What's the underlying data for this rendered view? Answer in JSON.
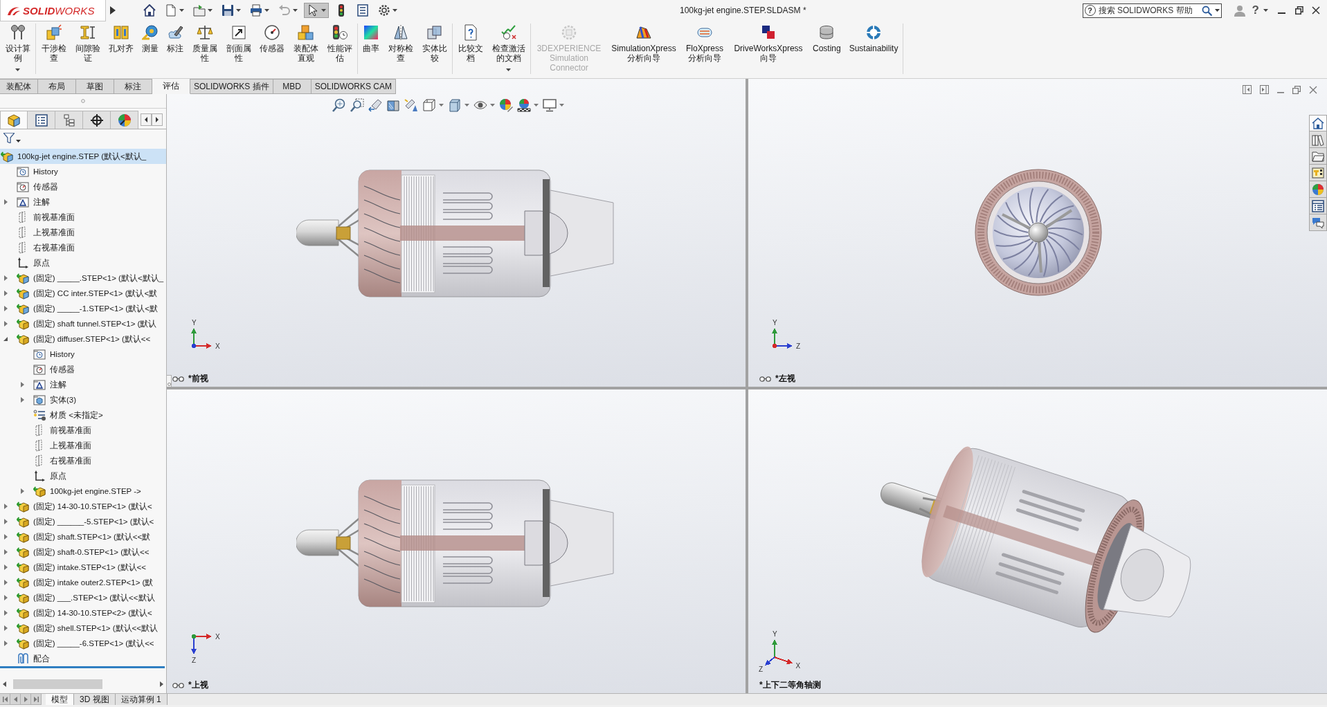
{
  "title_bar": {
    "logo": "**SOLID**WORKS",
    "quick_access": [
      {
        "dropdown": false,
        "disabled": false,
        "selected": false
      },
      {
        "dropdown": true,
        "disabled": false,
        "selected": false
      },
      {
        "dropdown": true,
        "disabled": false,
        "selected": false
      },
      {
        "dropdown": true,
        "disabled": false,
        "selected": false
      },
      {
        "dropdown": true,
        "disabled": false,
        "selected": false
      },
      {
        "dropdown": true,
        "disabled": true,
        "selected": false
      },
      {
        "dropdown": true,
        "disabled": false,
        "selected": true
      },
      {
        "dropdown": false,
        "disabled": false,
        "selected": false
      },
      {
        "dropdown": false,
        "disabled": false,
        "selected": false
      },
      {
        "dropdown": true,
        "disabled": false,
        "selected": false
      }
    ],
    "document_title": "100kg-jet engine.STEP.SLDASM *",
    "help_search": {
      "help_mark": "?",
      "placeholder": "搜索 SOLIDWORKS 帮助"
    },
    "help_menu": "?"
  },
  "command_manager": {
    "groups": [
      {
        "commands": [
          {
            "label": "设计算例",
            "dropdown": true,
            "disabled": false
          }
        ]
      },
      {
        "commands": [
          {
            "label": "干涉检查",
            "dropdown": false,
            "disabled": false
          },
          {
            "label": "间隙验证",
            "dropdown": false,
            "disabled": false
          },
          {
            "label": "孔对齐",
            "dropdown": false,
            "disabled": false
          },
          {
            "label": "测量",
            "dropdown": false,
            "disabled": false
          },
          {
            "label": "标注",
            "dropdown": false,
            "disabled": false
          },
          {
            "label": "质量属性",
            "dropdown": false,
            "disabled": false
          },
          {
            "label": "剖面属性",
            "dropdown": false,
            "disabled": false
          },
          {
            "label": "传感器",
            "dropdown": false,
            "disabled": false
          },
          {
            "label": "装配体直观",
            "dropdown": false,
            "disabled": false
          },
          {
            "label": "性能评估",
            "dropdown": false,
            "disabled": false
          }
        ]
      },
      {
        "commands": [
          {
            "label": "曲率",
            "dropdown": false,
            "disabled": false
          },
          {
            "label": "对称检查",
            "dropdown": false,
            "disabled": false
          },
          {
            "label": "实体比较",
            "dropdown": false,
            "disabled": false
          }
        ]
      },
      {
        "commands": [
          {
            "label": "比较文档",
            "dropdown": false,
            "disabled": false
          },
          {
            "label": "检查激活的文档",
            "dropdown": true,
            "disabled": false
          }
        ]
      },
      {
        "commands": [
          {
            "label": "3DEXPERIENCE Simulation Connector",
            "dropdown": false,
            "disabled": true
          },
          {
            "label": "SimulationXpress 分析向导",
            "dropdown": false,
            "disabled": false
          },
          {
            "label": "FloXpress 分析向导",
            "dropdown": false,
            "disabled": false
          },
          {
            "label": "DriveWorksXpress 向导",
            "dropdown": false,
            "disabled": false
          },
          {
            "label": "Costing",
            "dropdown": false,
            "disabled": false
          },
          {
            "label": "Sustainability",
            "dropdown": false,
            "disabled": false
          }
        ]
      }
    ]
  },
  "command_tabs": [
    {
      "label": "装配体",
      "selected": false
    },
    {
      "label": "布局",
      "selected": false
    },
    {
      "label": "草图",
      "selected": false
    },
    {
      "label": "标注",
      "selected": false
    },
    {
      "label": "评估",
      "selected": true
    },
    {
      "label": "SOLIDWORKS 插件",
      "selected": false
    },
    {
      "label": "MBD",
      "selected": false
    },
    {
      "label": "SOLIDWORKS CAM",
      "selected": false
    }
  ],
  "feature_manager": {
    "panel_tabs": [
      {
        "selected": true
      },
      {
        "selected": false
      },
      {
        "selected": false
      },
      {
        "selected": false
      },
      {
        "selected": false
      }
    ],
    "feature_tree": [
      {
        "kind": "assembly",
        "label": "100kg-jet engine.STEP (默认<默认_",
        "selected": true,
        "children": [
          {
            "kind": "history",
            "label": "History",
            "selected": false
          },
          {
            "kind": "sensors",
            "label": "传感器",
            "selected": false
          },
          {
            "kind": "annotations",
            "label": "注解",
            "selected": false,
            "expanded": false
          },
          {
            "kind": "plane",
            "label": "前视基准面",
            "selected": false
          },
          {
            "kind": "plane",
            "label": "上视基准面",
            "selected": false
          },
          {
            "kind": "plane",
            "label": "右视基准面",
            "selected": false
          },
          {
            "kind": "origin",
            "label": "原点",
            "selected": false
          },
          {
            "kind": "assembly",
            "label": "(固定) _____.STEP<1> (默认<默认_",
            "selected": false,
            "expanded": false
          },
          {
            "kind": "assembly",
            "label": "(固定) CC inter.STEP<1> (默认<默",
            "selected": false,
            "expanded": false
          },
          {
            "kind": "assembly",
            "label": "(固定) _____-1.STEP<1> (默认<默",
            "selected": false,
            "expanded": false
          },
          {
            "kind": "part",
            "label": "(固定) shaft tunnel.STEP<1> (默认",
            "selected": false,
            "expanded": false
          },
          {
            "kind": "part",
            "label": "(固定) diffuser.STEP<1> (默认<<",
            "selected": false,
            "expanded": true,
            "children": [
              {
                "kind": "history",
                "label": "History",
                "selected": false
              },
              {
                "kind": "sensors",
                "label": "传感器",
                "selected": false
              },
              {
                "kind": "annotations",
                "label": "注解",
                "selected": false,
                "expanded": false
              },
              {
                "kind": "bodies",
                "label": "实体(3)",
                "selected": false,
                "expanded": false
              },
              {
                "kind": "material",
                "label": "材质 <未指定>",
                "selected": false
              },
              {
                "kind": "plane",
                "label": "前视基准面",
                "selected": false
              },
              {
                "kind": "plane",
                "label": "上视基准面",
                "selected": false
              },
              {
                "kind": "plane",
                "label": "右视基准面",
                "selected": false
              },
              {
                "kind": "origin",
                "label": "原点",
                "selected": false
              },
              {
                "kind": "part",
                "label": "100kg-jet engine.STEP ->",
                "selected": false,
                "expanded": false
              }
            ]
          },
          {
            "kind": "part",
            "label": "(固定) 14-30-10.STEP<1> (默认<",
            "selected": false,
            "expanded": false
          },
          {
            "kind": "part",
            "label": "(固定) ______-5.STEP<1> (默认<",
            "selected": false,
            "expanded": false
          },
          {
            "kind": "part",
            "label": "(固定) shaft.STEP<1> (默认<<默",
            "selected": false,
            "expanded": false
          },
          {
            "kind": "part",
            "label": "(固定) shaft-0.STEP<1> (默认<<",
            "selected": false,
            "expanded": false
          },
          {
            "kind": "part",
            "label": "(固定) intake.STEP<1> (默认<<",
            "selected": false,
            "expanded": false
          },
          {
            "kind": "part",
            "label": "(固定) intake outer2.STEP<1> (默",
            "selected": false,
            "expanded": false
          },
          {
            "kind": "part",
            "label": "(固定) ___.STEP<1> (默认<<默认",
            "selected": false,
            "expanded": false
          },
          {
            "kind": "part",
            "label": "(固定) 14-30-10.STEP<2> (默认<",
            "selected": false,
            "expanded": false
          },
          {
            "kind": "part",
            "label": "(固定) shell.STEP<1> (默认<<默认",
            "selected": false,
            "expanded": false
          },
          {
            "kind": "part",
            "label": "(固定) _____-6.STEP<1> (默认<<",
            "selected": false,
            "expanded": false
          },
          {
            "kind": "mates",
            "label": "配合",
            "selected": false
          }
        ]
      }
    ]
  },
  "graphics_area": {
    "heads_up_toolbar": [
      {
        "dropdown": false
      },
      {
        "dropdown": false
      },
      {
        "dropdown": false
      },
      {
        "dropdown": false
      },
      {
        "dropdown": false
      },
      {
        "dropdown": true
      },
      {
        "dropdown": true
      },
      {
        "dropdown": true
      },
      {
        "dropdown": false
      },
      {
        "dropdown": true
      },
      {
        "dropdown": true
      }
    ],
    "viewports": [
      {
        "kind": "front",
        "label": "*前视",
        "linked": true,
        "axes": [
          {
            "kind": "up",
            "label": "Y",
            "color": "#2e9a3a"
          },
          {
            "kind": "right",
            "label": "X",
            "color": "#d42a2a"
          },
          {
            "kind": "toward",
            "color": "#2a3fd0"
          }
        ]
      },
      {
        "kind": "left",
        "label": "*左视",
        "linked": true,
        "axes": [
          {
            "kind": "up",
            "label": "Y",
            "color": "#2e9a3a"
          },
          {
            "kind": "right",
            "label": "Z",
            "color": "#2a3fd0"
          },
          {
            "kind": "toward",
            "color": "#d42a2a"
          }
        ]
      },
      {
        "kind": "top",
        "label": "*上视",
        "linked": true,
        "axes": [
          {
            "kind": "right",
            "label": "X",
            "color": "#d42a2a"
          },
          {
            "kind": "down",
            "label": "Z",
            "color": "#2a3fd0"
          },
          {
            "kind": "toward",
            "color": "#2e9a3a"
          }
        ]
      },
      {
        "kind": "iso",
        "label": "*上下二等角轴测",
        "linked": false,
        "axes": [
          {
            "kind": "up",
            "label": "Y",
            "color": "#2e9a3a"
          },
          {
            "kind": "right-down",
            "label": "X",
            "color": "#d42a2a"
          },
          {
            "kind": "left-down",
            "label": "Z",
            "color": "#2a3fd0"
          }
        ]
      }
    ],
    "task_pane": [
      {
        "selected": true
      },
      {
        "selected": false
      },
      {
        "selected": false
      },
      {
        "selected": false
      },
      {
        "selected": false
      },
      {
        "selected": false
      },
      {
        "selected": false
      }
    ]
  },
  "bottom_tabs": [
    {
      "label": "模型",
      "selected": true
    },
    {
      "label": "3D 视图",
      "selected": false
    },
    {
      "label": "运动算例 1",
      "selected": false
    }
  ]
}
